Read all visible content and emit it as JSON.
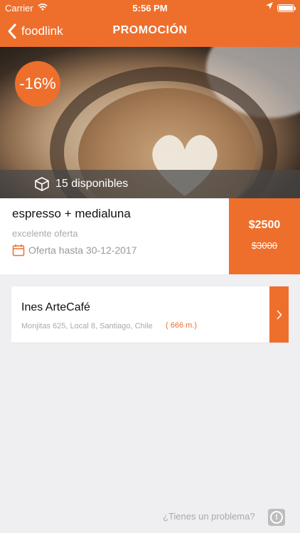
{
  "status": {
    "carrier": "Carrier",
    "time": "5:56 PM"
  },
  "nav": {
    "back_label": "foodlink",
    "title": "PROMOCIÓN"
  },
  "hero": {
    "discount": "-16%",
    "available": "15 disponibles"
  },
  "offer": {
    "name": "espresso + medialuna",
    "subtitle": "excelente oferta",
    "valid_until": "Oferta hasta 30-12-2017",
    "price_now": "$2500",
    "price_before": "$3000"
  },
  "store": {
    "name": "Ines ArteCafé",
    "address": "Monjitas 625, Local 8, Santiago, Chile",
    "distance": "( 666 m.)"
  },
  "footer": {
    "problem": "¿Tienes un problema?"
  },
  "colors": {
    "accent": "#ee6f2c",
    "background": "#efeef0"
  },
  "icons": {
    "back": "chevron-left-icon",
    "available": "box-icon",
    "calendar": "calendar-icon",
    "store_arrow": "chevron-right-icon",
    "info": "info-icon"
  }
}
